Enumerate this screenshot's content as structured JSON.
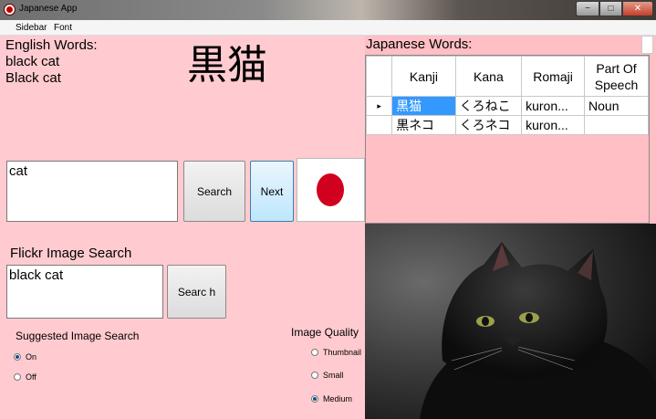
{
  "window": {
    "title": "Japanese App"
  },
  "menu": {
    "items": [
      "Sidebar",
      "Font"
    ]
  },
  "english": {
    "heading": "English Words:",
    "words": [
      "black cat",
      "Black cat"
    ]
  },
  "kanji_display": "黒猫",
  "search": {
    "value": "cat",
    "search_label": "Search",
    "next_label": "Next"
  },
  "japanese": {
    "heading": "Japanese Words:",
    "columns": [
      "Kanji",
      "Kana",
      "Romaji",
      "Part Of Speech"
    ],
    "rows": [
      {
        "marker": "▸",
        "kanji": "黒猫",
        "kana": "くろねこ",
        "romaji": "kuron...",
        "pos": "Noun"
      },
      {
        "marker": "",
        "kanji": "黒ネコ",
        "kana": "くろネコ",
        "romaji": "kuron...",
        "pos": ""
      }
    ]
  },
  "flickr": {
    "heading": "Flickr Image Search",
    "value": "black cat",
    "search_label": "Searc h"
  },
  "suggested": {
    "heading": "Suggested Image Search",
    "options": [
      "On",
      "Off"
    ],
    "selected": "On"
  },
  "quality": {
    "heading": "Image Quality",
    "options": [
      "Thumbnail",
      "Small",
      "Medium"
    ],
    "selected": "Medium"
  },
  "colors": {
    "panel_pink": "#ffcbd0",
    "grid_pink": "#ffbfc4",
    "selection": "#3399ff",
    "flag_red": "#d1001f"
  },
  "icons": {
    "app": "app-record-icon",
    "photo": "black-cat-photo"
  }
}
